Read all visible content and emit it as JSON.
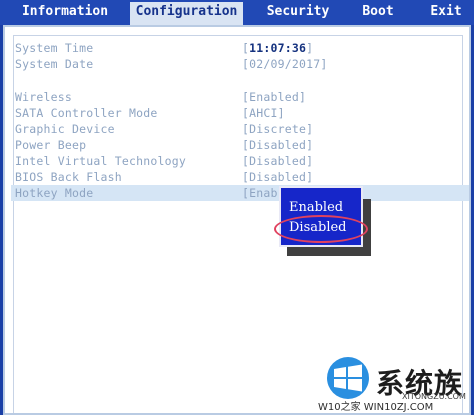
{
  "tabs": [
    {
      "label": "Information",
      "active": false
    },
    {
      "label": "Configuration",
      "active": true
    },
    {
      "label": "Security",
      "active": false
    },
    {
      "label": "Boot",
      "active": false
    },
    {
      "label": "Exit",
      "active": false
    }
  ],
  "system": {
    "time_label": "System Time",
    "time_open": "[",
    "time_value": "11:07:36",
    "time_close": "]",
    "date_label": "System Date",
    "date_value": "[02/09/2017]"
  },
  "settings": [
    {
      "label": "Wireless",
      "value": "[Enabled]"
    },
    {
      "label": "SATA Controller Mode",
      "value": "[AHCI]"
    },
    {
      "label": "Graphic Device",
      "value": "[Discrete]"
    },
    {
      "label": "Power Beep",
      "value": "[Disabled]"
    },
    {
      "label": "Intel Virtual Technology",
      "value": "[Disabled]"
    },
    {
      "label": "BIOS Back Flash",
      "value": "[Disabled]"
    },
    {
      "label": "Hotkey Mode",
      "value": "[Enab"
    }
  ],
  "popup": {
    "options": [
      "Enabled",
      "Disabled"
    ],
    "selected": "Disabled"
  },
  "watermark": {
    "text": "W10之家 WIN10ZJ.COM",
    "brand": "系统族",
    "brand_url": "XITONGZU.COM"
  },
  "colors": {
    "tabbar": "#2149b5",
    "popup": "#1626c9",
    "highlight": "#e0425f",
    "text_dim": "#8ea4c2",
    "text_value": "#15327f"
  }
}
